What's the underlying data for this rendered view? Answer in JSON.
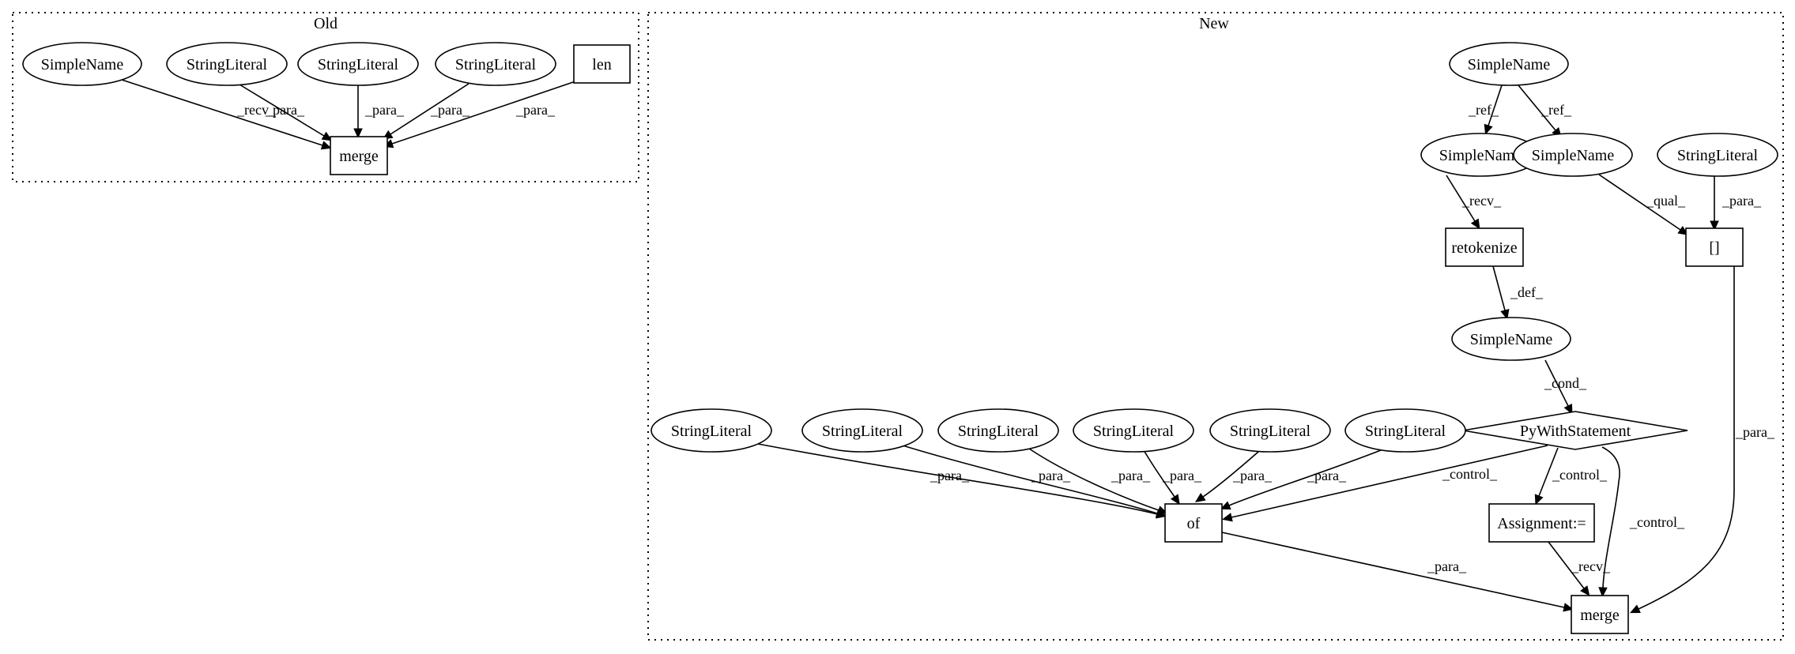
{
  "clusters": {
    "old": {
      "label": "Old"
    },
    "new": {
      "label": "New"
    }
  },
  "nodes": {
    "o_sn": {
      "label": "SimpleName",
      "shape": "ellipse"
    },
    "o_sl1": {
      "label": "StringLiteral",
      "shape": "ellipse"
    },
    "o_sl2": {
      "label": "StringLiteral",
      "shape": "ellipse"
    },
    "o_sl3": {
      "label": "StringLiteral",
      "shape": "ellipse"
    },
    "o_len": {
      "label": "len",
      "shape": "box"
    },
    "o_merge": {
      "label": "merge",
      "shape": "box"
    },
    "n_sn_top": {
      "label": "SimpleName",
      "shape": "ellipse"
    },
    "n_sn_l": {
      "label": "SimpleName",
      "shape": "ellipse"
    },
    "n_sn_r": {
      "label": "SimpleName",
      "shape": "ellipse"
    },
    "n_sl_r": {
      "label": "StringLiteral",
      "shape": "ellipse"
    },
    "n_retok": {
      "label": "retokenize",
      "shape": "box"
    },
    "n_idx": {
      "label": "[]",
      "shape": "box"
    },
    "n_sn_mid": {
      "label": "SimpleName",
      "shape": "ellipse"
    },
    "n_with": {
      "label": "PyWithStatement",
      "shape": "diamond"
    },
    "n_sl1": {
      "label": "StringLiteral",
      "shape": "ellipse"
    },
    "n_sl2": {
      "label": "StringLiteral",
      "shape": "ellipse"
    },
    "n_sl3": {
      "label": "StringLiteral",
      "shape": "ellipse"
    },
    "n_sl4": {
      "label": "StringLiteral",
      "shape": "ellipse"
    },
    "n_sl5": {
      "label": "StringLiteral",
      "shape": "ellipse"
    },
    "n_sl6": {
      "label": "StringLiteral",
      "shape": "ellipse"
    },
    "n_of": {
      "label": "of",
      "shape": "box"
    },
    "n_assign": {
      "label": "Assignment:=",
      "shape": "box"
    },
    "n_merge": {
      "label": "merge",
      "shape": "box"
    }
  },
  "edges": [
    {
      "id": "e1",
      "from": "o_sn",
      "to": "o_merge",
      "label": "_recv_"
    },
    {
      "id": "e2",
      "from": "o_sl1",
      "to": "o_merge",
      "label": "_para_"
    },
    {
      "id": "e3",
      "from": "o_sl2",
      "to": "o_merge",
      "label": "_para_"
    },
    {
      "id": "e4",
      "from": "o_sl3",
      "to": "o_merge",
      "label": "_para_"
    },
    {
      "id": "e5",
      "from": "o_len",
      "to": "o_merge",
      "label": "_para_"
    },
    {
      "id": "e6",
      "from": "n_sn_top",
      "to": "n_sn_l",
      "label": "_ref_"
    },
    {
      "id": "e7",
      "from": "n_sn_top",
      "to": "n_sn_r",
      "label": "_ref_"
    },
    {
      "id": "e8",
      "from": "n_sn_l",
      "to": "n_retok",
      "label": "_recv_"
    },
    {
      "id": "e9",
      "from": "n_sn_r",
      "to": "n_idx",
      "label": "_qual_"
    },
    {
      "id": "e10",
      "from": "n_sl_r",
      "to": "n_idx",
      "label": "_para_"
    },
    {
      "id": "e11",
      "from": "n_retok",
      "to": "n_sn_mid",
      "label": "_def_"
    },
    {
      "id": "e12",
      "from": "n_sn_mid",
      "to": "n_with",
      "label": "_cond_"
    },
    {
      "id": "e13",
      "from": "n_idx",
      "to": "n_merge",
      "label": "_para_"
    },
    {
      "id": "e14",
      "from": "n_with",
      "to": "n_of",
      "label": "_control_"
    },
    {
      "id": "e15",
      "from": "n_with",
      "to": "n_assign",
      "label": "_control_"
    },
    {
      "id": "e16",
      "from": "n_with",
      "to": "n_merge",
      "label": "_control_"
    },
    {
      "id": "e17",
      "from": "n_sl1",
      "to": "n_of",
      "label": "_para_"
    },
    {
      "id": "e18",
      "from": "n_sl2",
      "to": "n_of",
      "label": "_para_"
    },
    {
      "id": "e19",
      "from": "n_sl3",
      "to": "n_of",
      "label": "_para_"
    },
    {
      "id": "e20",
      "from": "n_sl4",
      "to": "n_of",
      "label": "_para_"
    },
    {
      "id": "e21",
      "from": "n_sl5",
      "to": "n_of",
      "label": "_para_"
    },
    {
      "id": "e22",
      "from": "n_sl6",
      "to": "n_of",
      "label": "_para_"
    },
    {
      "id": "e23",
      "from": "n_of",
      "to": "n_merge",
      "label": "_para_"
    },
    {
      "id": "e24",
      "from": "n_assign",
      "to": "n_merge",
      "label": "_recv_"
    }
  ]
}
